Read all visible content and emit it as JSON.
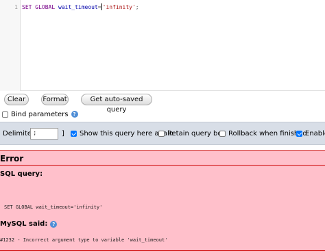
{
  "editor": {
    "line_number": "1",
    "code": {
      "keyword": "SET GLOBAL",
      "variable": "wait_timeout",
      "operator": "=",
      "value": "'infinity'",
      "terminator": ";"
    }
  },
  "buttons": {
    "clear": "Clear",
    "format": "Format",
    "autosaved": "Get auto-saved query"
  },
  "bind_parameters": {
    "label": "Bind parameters",
    "checked": false
  },
  "options": {
    "delimiter_label": "Delimiter",
    "delimiter_value": ";",
    "delimiter_bracket": "]",
    "show_query": {
      "label": "Show this query here again",
      "checked": true
    },
    "retain_box": {
      "label": "Retain query box",
      "checked": false
    },
    "rollback": {
      "label": "Rollback when finished",
      "checked": false
    },
    "enable": {
      "label": "Enable",
      "checked": true
    }
  },
  "error": {
    "title": "Error",
    "sql_query_label": "SQL query:",
    "query_text": "SET GLOBAL wait_timeout='infinity'",
    "mysql_said_label": "MySQL said:",
    "message": "#1232 - Incorrect argument type to variable 'wait_timeout'"
  },
  "colors": {
    "error_bg": "#ffc0cb",
    "error_border": "#cc0000",
    "options_bg": "#d8dee7",
    "checkbox_accent": "#0075ff"
  },
  "icons": {
    "help": "help-icon"
  }
}
